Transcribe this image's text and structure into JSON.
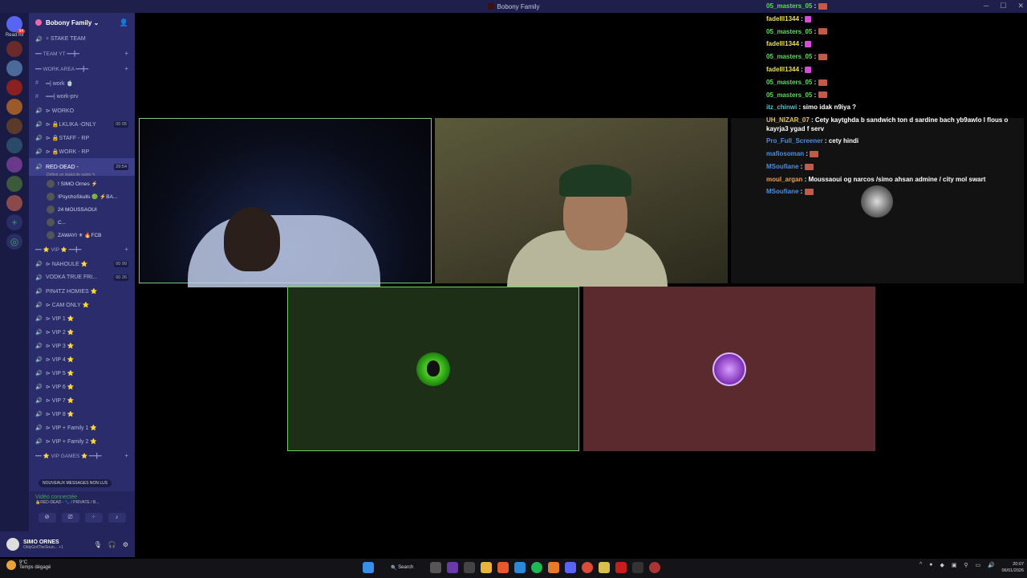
{
  "window": {
    "title": "Bobony Family"
  },
  "servers": {
    "read_all": "Read All",
    "badge_top": "94"
  },
  "sidebar": {
    "server_name": "Bobony Family",
    "channels": [
      {
        "type": "cat-chan",
        "label": "⸰ STAKE TEAM"
      },
      {
        "type": "cat",
        "label": "━━ TEAM YT ━━╋━"
      },
      {
        "type": "cat",
        "label": "━━ WORK AREA ━━╋━"
      },
      {
        "type": "text",
        "label": "═| work 🍵"
      },
      {
        "type": "text",
        "label": "══| work-prv"
      },
      {
        "type": "voice",
        "label": "⊳ WORKO"
      },
      {
        "type": "voice",
        "label": "⊳ 🔒LKLIKA -ONLY",
        "count": "00 05"
      },
      {
        "type": "voice",
        "label": "⊳ 🔒STAFF - RP"
      },
      {
        "type": "voice",
        "label": "⊳ 🔒WORK - RP"
      }
    ],
    "active_channel": {
      "label": "RED-DEAD -",
      "count": "29:54",
      "status": "Définir un statut de salon ✎"
    },
    "members": [
      {
        "name": "! SIMO Ornes ⚡"
      },
      {
        "name": "!PsychoSkulls 🟢 ⚡BA..."
      },
      {
        "name": "24 MOUSSAOUI"
      },
      {
        "name": "C..."
      },
      {
        "name": "ZAWAYI ⚜ 🔥FCB"
      }
    ],
    "channels2": [
      {
        "type": "cat",
        "label": "━━ ⭐ VIP ⭐ ━━╋━"
      },
      {
        "type": "voice",
        "label": "⊳ NAHOULE ⭐",
        "count": "00 99"
      },
      {
        "type": "voice",
        "label": "VODKA TRUE FRI...",
        "count": "00 26"
      },
      {
        "type": "voice",
        "label": "PIN4TZ HOMIES ⭐"
      },
      {
        "type": "voice",
        "label": "⊳ CAM ONLY ⭐"
      },
      {
        "type": "voice",
        "label": "⊳ VIP 1 ⭐"
      },
      {
        "type": "voice",
        "label": "⊳ VIP 2 ⭐"
      },
      {
        "type": "voice",
        "label": "⊳ VIP 3 ⭐"
      },
      {
        "type": "voice",
        "label": "⊳ VIP 4 ⭐"
      },
      {
        "type": "voice",
        "label": "⊳ VIP 5 ⭐"
      },
      {
        "type": "voice",
        "label": "⊳ VIP 6 ⭐"
      },
      {
        "type": "voice",
        "label": "⊳ VIP 7 ⭐"
      },
      {
        "type": "voice",
        "label": "⊳ VIP 8 ⭐"
      },
      {
        "type": "voice",
        "label": "⊳ VIP + Family 1 ⭐"
      },
      {
        "type": "voice",
        "label": "⊳ VIP + Family 2 ⭐"
      },
      {
        "type": "cat",
        "label": "━━ ⭐ VIP GAMES ⭐ ━━╋━"
      }
    ],
    "new_messages": "NOUVEAUX MESSAGES NON LUS"
  },
  "voice_panel": {
    "title": "Vidéo connectée",
    "subtitle": "🔒RED-DEAD - 🐾 / PRIVATE / B..."
  },
  "user_panel": {
    "name": "SIMO ORNES",
    "status": "OldyGotTheSoun... +1"
  },
  "chat": [
    {
      "user": "05_masters_05",
      "color": "u-green",
      "emote": "box",
      "text": ""
    },
    {
      "user": "fadelll1344",
      "color": "u-yellow",
      "emote": "heart",
      "text": ""
    },
    {
      "user": "05_masters_05",
      "color": "u-green",
      "emote": "box",
      "text": ""
    },
    {
      "user": "fadelll1344",
      "color": "u-yellow",
      "emote": "heart",
      "text": ""
    },
    {
      "user": "05_masters_05",
      "color": "u-green",
      "emote": "box",
      "text": ""
    },
    {
      "user": "fadelll1344",
      "color": "u-yellow",
      "emote": "heart",
      "text": ""
    },
    {
      "user": "05_masters_05",
      "color": "u-green",
      "emote": "box",
      "text": ""
    },
    {
      "user": "05_masters_05",
      "color": "u-green",
      "emote": "box",
      "text": ""
    },
    {
      "user": "itz_chinwi",
      "color": "u-cyan",
      "emote": "",
      "text": "simo idak n9iya ?"
    },
    {
      "user": "UH_NIZAR_07",
      "color": "u-gold",
      "emote": "",
      "text": "Cety kaytghda b sandwich ton d sardine bach yb9awlo l flous o kayrja3 ygad f serv",
      "wrap": true
    },
    {
      "user": "Pro_Full_Screener",
      "color": "u-blue",
      "emote": "",
      "text": "cety hindi"
    },
    {
      "user": "mafiosoman",
      "color": "u-blue",
      "emote": "box",
      "text": ""
    },
    {
      "user": "MSoufiane",
      "color": "u-blue",
      "emote": "box",
      "text": ""
    },
    {
      "user": "moul_argan",
      "color": "u-orange",
      "emote": "",
      "text": "Moussaoui og narcos /simo ahsan admine / city mol swart"
    },
    {
      "user": "MSoufiane",
      "color": "u-blue",
      "emote": "box",
      "text": ""
    }
  ],
  "taskbar": {
    "weather_temp": "9°C",
    "weather_desc": "Temps dégagé",
    "search_label": "Search",
    "time": "20:07",
    "date": "06/01/2026"
  }
}
